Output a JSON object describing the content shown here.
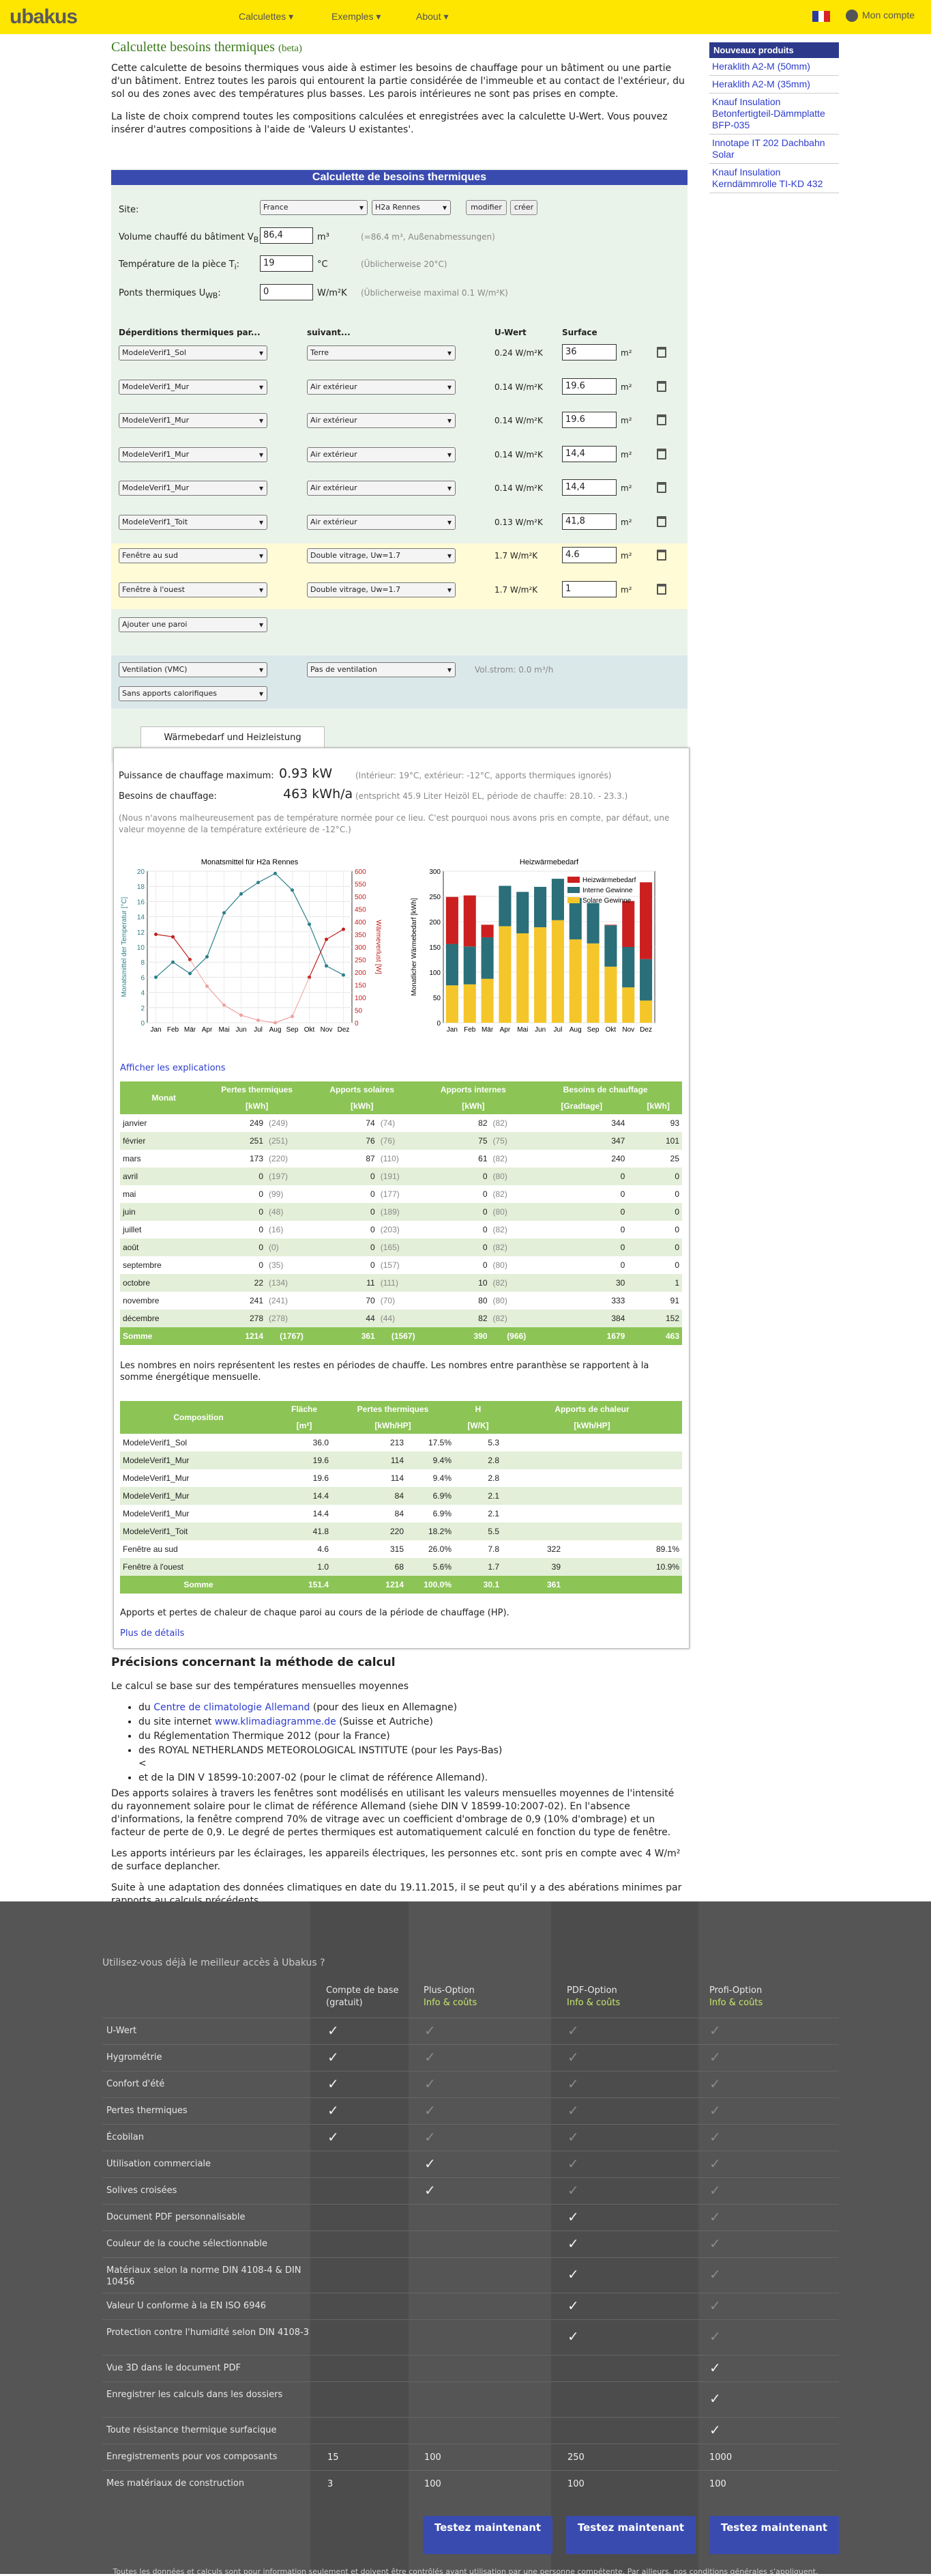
{
  "header": {
    "logo": "ubakus",
    "nav": [
      "Calculettes ▾",
      "Exemples ▾",
      "About ▾"
    ],
    "account": "Mon compte"
  },
  "sidebar": {
    "title": "Nouveaux produits",
    "items": [
      "Heraklith A2-M (50mm)",
      "Heraklith A2-M (35mm)",
      "Knauf Insulation Betonfertigteil-Dämmplatte BFP-035",
      "Innotape IT 202 Dachbahn Solar",
      "Knauf Insulation Kerndämmrolle TI-KD 432"
    ]
  },
  "page": {
    "title": "Calculette besoins thermiques",
    "beta": "(beta)",
    "intro1": "Cette calculette de besoins thermiques vous aide à estimer les besoins de chauffage pour un bâtiment ou une partie d'un bâtiment. Entrez toutes les parois qui entourent la partie considérée de l'immeuble et au contact de l'extérieur, du sol ou des zones avec des températures plus basses. Les parois intérieures ne sont pas prises en compte.",
    "intro2": "La liste de choix comprend toutes les compositions calculées et enregistrées avec la calculette U-Wert. Vous pouvez insérer d'autres compositions à l'aide de 'Valeurs U existantes'."
  },
  "form": {
    "title": "Calculette de besoins thermiques",
    "site_label": "Site:",
    "country": "France",
    "city": "H2a Rennes",
    "modify": "modifier",
    "create": "créer",
    "volume_label": "Volume chauffé du bâtiment V",
    "volume_sub": "B",
    "volume_value": "86,4",
    "volume_unit": "m³",
    "volume_hint": "(=86.4 m³, Außenabmessungen)",
    "temp_label": "Température de la pièce T",
    "temp_sub": "i",
    "temp_value": "19",
    "temp_unit": "°C",
    "temp_hint": "(Üblicherweise 20°C)",
    "bridge_label": "Ponts thermiques U",
    "bridge_sub": "WB",
    "bridge_value": "0",
    "bridge_unit": "W/m²K",
    "bridge_hint": "(Üblicherweise maximal 0.1 W/m²K)",
    "col_walls": "Déperditions thermiques par...",
    "col_next": "suivant...",
    "col_u": "U-Wert",
    "col_area": "Surface",
    "walls": [
      {
        "name": "ModeleVerif1_Sol",
        "next": "Terre",
        "u": "0.24 W/m²K",
        "area": "36",
        "unit": "m²"
      },
      {
        "name": "ModeleVerif1_Mur",
        "next": "Air extérieur",
        "u": "0.14 W/m²K",
        "area": "19.6",
        "unit": "m²"
      },
      {
        "name": "ModeleVerif1_Mur",
        "next": "Air extérieur",
        "u": "0.14 W/m²K",
        "area": "19.6",
        "unit": "m²"
      },
      {
        "name": "ModeleVerif1_Mur",
        "next": "Air extérieur",
        "u": "0.14 W/m²K",
        "area": "14,4",
        "unit": "m²"
      },
      {
        "name": "ModeleVerif1_Mur",
        "next": "Air extérieur",
        "u": "0.14 W/m²K",
        "area": "14,4",
        "unit": "m²"
      },
      {
        "name": "ModeleVerif1_Toit",
        "next": "Air extérieur",
        "u": "0.13 W/m²K",
        "area": "41,8",
        "unit": "m²"
      },
      {
        "name": "Fenêtre au sud",
        "next": "Double vitrage, Uw=1.7",
        "u": "1.7 W/m²K",
        "area": "4.6",
        "unit": "m²"
      },
      {
        "name": "Fenêtre à l'ouest",
        "next": "Double vitrage, Uw=1.7",
        "u": "1.7 W/m²K",
        "area": "1",
        "unit": "m²"
      }
    ],
    "add_wall": "Ajouter une paroi",
    "ventilation": "Ventilation (VMC)",
    "no_vent": "Pas de ventilation",
    "vol_strom": "Vol.strom: 0.0 m³/h",
    "no_gain": "Sans apports calorifiques"
  },
  "results": {
    "tab": "Wärmebedarf und Heizleistung",
    "power_label": "Puissance de chauffage maximum:",
    "power_value": "0.93 kW",
    "power_hint": "(Intérieur: 19°C, extérieur: -12°C, apports thermiques ignorés)",
    "need_label": "Besoins de chauffage:",
    "need_value": "463 kWh/a",
    "need_hint": "(entspricht 45.9 Liter Heizöl EL, période de chauffe: 28.10. - 23.3.)",
    "note": "(Nous n'avons malheureusement pas de température normée pour ce lieu. C'est pourquoi nous avons pris en compte, par défaut, une valeur moyenne de la température extérieure de -12°C.)",
    "show_expl": "Afficher les explications",
    "table_note": "Les nombres en noirs représentent les restes en périodes de chauffe. Les nombres entre paranthèse se rapportent à la somme énergétique mensuelle.",
    "comp_note": "Apports et pertes de chaleur de chaque paroi au cours de la période de chauffage (HP).",
    "more": "Plus de détails"
  },
  "monthly": {
    "headers": [
      "Monat",
      "Pertes thermiques",
      "Apports solaires",
      "Apports internes",
      "Besoins de chauffage"
    ],
    "units": [
      "[kWh]",
      "[kWh]",
      "[kWh]",
      "[Gradtage]",
      "[kWh]"
    ],
    "rows": [
      [
        "janvier",
        "249",
        "(249)",
        "74",
        "(74)",
        "82",
        "(82)",
        "344",
        "93"
      ],
      [
        "février",
        "251",
        "(251)",
        "76",
        "(76)",
        "75",
        "(75)",
        "347",
        "101"
      ],
      [
        "mars",
        "173",
        "(220)",
        "87",
        "(110)",
        "61",
        "(82)",
        "240",
        "25"
      ],
      [
        "avril",
        "0",
        "(197)",
        "0",
        "(191)",
        "0",
        "(80)",
        "0",
        "0"
      ],
      [
        "mai",
        "0",
        "(99)",
        "0",
        "(177)",
        "0",
        "(82)",
        "0",
        "0"
      ],
      [
        "juin",
        "0",
        "(48)",
        "0",
        "(189)",
        "0",
        "(80)",
        "0",
        "0"
      ],
      [
        "juillet",
        "0",
        "(16)",
        "0",
        "(203)",
        "0",
        "(82)",
        "0",
        "0"
      ],
      [
        "août",
        "0",
        "(0)",
        "0",
        "(165)",
        "0",
        "(82)",
        "0",
        "0"
      ],
      [
        "septembre",
        "0",
        "(35)",
        "0",
        "(157)",
        "0",
        "(80)",
        "0",
        "0"
      ],
      [
        "octobre",
        "22",
        "(134)",
        "11",
        "(111)",
        "10",
        "(82)",
        "30",
        "1"
      ],
      [
        "novembre",
        "241",
        "(241)",
        "70",
        "(70)",
        "80",
        "(80)",
        "333",
        "91"
      ],
      [
        "décembre",
        "278",
        "(278)",
        "44",
        "(44)",
        "82",
        "(82)",
        "384",
        "152"
      ]
    ],
    "sum": [
      "Somme",
      "1214",
      "(1767)",
      "361",
      "(1567)",
      "390",
      "(966)",
      "1679",
      "463"
    ]
  },
  "comp": {
    "headers": [
      "Composition",
      "Fläche",
      "Pertes thermiques",
      "H",
      "Apports de chaleur"
    ],
    "units": [
      "[m²]",
      "[kWh/HP]",
      "[W/K]",
      "[kWh/HP]"
    ],
    "rows": [
      [
        "ModeleVerif1_Sol",
        "36.0",
        "213",
        "17.5%",
        "5.3",
        "",
        ""
      ],
      [
        "ModeleVerif1_Mur",
        "19.6",
        "114",
        "9.4%",
        "2.8",
        "",
        ""
      ],
      [
        "ModeleVerif1_Mur",
        "19.6",
        "114",
        "9.4%",
        "2.8",
        "",
        ""
      ],
      [
        "ModeleVerif1_Mur",
        "14.4",
        "84",
        "6.9%",
        "2.1",
        "",
        ""
      ],
      [
        "ModeleVerif1_Mur",
        "14.4",
        "84",
        "6.9%",
        "2.1",
        "",
        ""
      ],
      [
        "ModeleVerif1_Toit",
        "41.8",
        "220",
        "18.2%",
        "5.5",
        "",
        ""
      ],
      [
        "Fenêtre au sud",
        "4.6",
        "315",
        "26.0%",
        "7.8",
        "322",
        "89.1%"
      ],
      [
        "Fenêtre à l'ouest",
        "1.0",
        "68",
        "5.6%",
        "1.7",
        "39",
        "10.9%"
      ]
    ],
    "sum": [
      "Somme",
      "151.4",
      "1214",
      "100.0%",
      "30.1",
      "361",
      ""
    ]
  },
  "chart_data": [
    {
      "type": "line",
      "title": "Monatsmittel für H2a Rennes",
      "categories": [
        "Jan",
        "Feb",
        "Mär",
        "Apr",
        "Mai",
        "Jun",
        "Jul",
        "Aug",
        "Sep",
        "Okt",
        "Nov",
        "Dez"
      ],
      "ylabel": "Monatsmittel der Temperatur [°C]",
      "y2label": "Wärmeverlust [W]",
      "ylim": [
        0,
        20
      ],
      "y2lim": [
        0,
        600
      ],
      "yticks": [
        "0",
        "2",
        "4",
        "6",
        "8",
        "10",
        "12",
        "14",
        "16",
        "18",
        "20"
      ],
      "y2ticks": [
        "0",
        "50",
        "100",
        "150",
        "200",
        "250",
        "300",
        "350",
        "400",
        "450",
        "500",
        "550",
        "600"
      ],
      "series": [
        {
          "name": "",
          "values": [
            6.0,
            8.0,
            6.5,
            8.7,
            14.5,
            17.0,
            18.5,
            19.7,
            17.5,
            13.0,
            7.5,
            6.3
          ],
          "color": "#2a7f8a"
        },
        {
          "values": [
            350,
            340,
            250,
            null,
            null,
            null,
            null,
            null,
            null,
            180,
            330,
            370
          ],
          "color": "#c0201c"
        },
        {
          "values": [
            null,
            null,
            null,
            145,
            70,
            30,
            10,
            0,
            25,
            null,
            null,
            null
          ],
          "color": "#f0a0a0"
        }
      ]
    },
    {
      "type": "bar",
      "title": "Heizwärmebedarf",
      "categories": [
        "Jan",
        "Feb",
        "Mär",
        "Apr",
        "Mai",
        "Jun",
        "Jul",
        "Aug",
        "Sep",
        "Okt",
        "Nov",
        "Dez"
      ],
      "ylabel": "Monatlicher Wärmebedarf [kWh]",
      "ylim": [
        0,
        300
      ],
      "yticks": [
        "0",
        "50",
        "100",
        "150",
        "200",
        "250",
        "300"
      ],
      "legend": [
        "Heizwärmebedarf",
        "Interne Gewinne",
        "Solare Gewinne"
      ],
      "series": [
        {
          "name": "Solare Gewinne",
          "values": [
            74,
            76,
            87,
            191,
            177,
            189,
            203,
            165,
            157,
            111,
            70,
            44
          ],
          "color": "#f5c629"
        },
        {
          "name": "Interne Gewinne",
          "values": [
            82,
            75,
            82,
            80,
            82,
            80,
            82,
            82,
            80,
            82,
            80,
            82
          ],
          "color": "#2a6f79"
        },
        {
          "name": "Heizwärmebedarf",
          "values": [
            93,
            101,
            25,
            0,
            0,
            0,
            0,
            0,
            0,
            1,
            91,
            152
          ],
          "color": "#cc1f1f"
        }
      ]
    }
  ],
  "method": {
    "title": "Précisions concernant la méthode de calcul",
    "p1": "Le calcul se base sur des températures mensuelles moyennes",
    "li1a": "du ",
    "li1b": "Centre de climatologie Allemand",
    "li1c": " (pour des lieux en Allemagne)",
    "li2a": "du site internet ",
    "li2b": "www.klimadiagramme.de",
    "li2c": " (Suisse et Autriche)",
    "li3": "du Réglementation Thermique 2012 (pour la France)",
    "li4": "des ROYAL NETHERLANDS METEOROLOGICAL INSTITUTE (pour les Pays-Bas)",
    "li4b": "<",
    "li5": "et de la DIN V 18599-10:2007-02 (pour le climat de référence Allemand).",
    "p2": "Des apports solaires à travers les fenêtres sont modélisés en utilisant les valeurs mensuelles moyennes de l'intensité du rayonnement solaire pour le climat de référence Allemand (siehe DIN V 18599-10:2007-02). En l'absence d'informations, la fenêtre comprend 70% de vitrage avec un coefficient d'ombrage de 0,9 (10% d'ombrage) et un facteur de perte de 0,9. Le degré de pertes thermiques est automatiquement calculé en fonction du type de fenêtre.",
    "p3": "Les apports intérieurs par les éclairages, les appareils électriques, les personnes etc. sont pris en compte avec 4 W/m² de surface deplancher.",
    "p4": "Suite à une adaptation des données climatiques en date du 19.11.2015, il se peut qu'il y a des abérations minimes par rapports au calculs précédents"
  },
  "footer": {
    "question": "Utilisez-vous déjà le meilleur accès à Ubakus ?",
    "cols": [
      {
        "title": "Compte de base",
        "sub": "(gratuit)"
      },
      {
        "title": "Plus-Option",
        "sub": "Info & coûts"
      },
      {
        "title": "PDF-Option",
        "sub": "Info & coûts"
      },
      {
        "title": "Profi-Option",
        "sub": "Info & coûts"
      }
    ],
    "features": [
      {
        "label": "U-Wert",
        "c": [
          "y",
          "d",
          "d",
          "d"
        ]
      },
      {
        "label": "Hygrométrie",
        "c": [
          "y",
          "d",
          "d",
          "d"
        ]
      },
      {
        "label": "Confort d'été",
        "c": [
          "y",
          "d",
          "d",
          "d"
        ]
      },
      {
        "label": "Pertes thermiques",
        "c": [
          "y",
          "d",
          "d",
          "d"
        ]
      },
      {
        "label": "Écobilan",
        "c": [
          "y",
          "d",
          "d",
          "d"
        ]
      },
      {
        "label": "Utilisation commerciale",
        "c": [
          "",
          "y",
          "d",
          "d"
        ]
      },
      {
        "label": "Solives croisées",
        "c": [
          "",
          "y",
          "d",
          "d"
        ]
      },
      {
        "label": "Document PDF personnalisable",
        "c": [
          "",
          "",
          "y",
          "d"
        ]
      },
      {
        "label": "Couleur de la couche sélectionnable",
        "c": [
          "",
          "",
          "y",
          "d"
        ]
      },
      {
        "label": "Matériaux selon la norme DIN 4108-4 & DIN 10456",
        "c": [
          "",
          "",
          "y",
          "d"
        ]
      },
      {
        "label": "Valeur U conforme à la EN ISO 6946",
        "c": [
          "",
          "",
          "y",
          "d"
        ]
      },
      {
        "label": "Protection contre l'humidité selon DIN 4108-3",
        "c": [
          "",
          "",
          "y",
          "d"
        ]
      },
      {
        "label": "Vue 3D dans le document PDF",
        "c": [
          "",
          "",
          "",
          "y"
        ]
      },
      {
        "label": "Enregistrer les calculs dans les dossiers",
        "c": [
          "",
          "",
          "",
          "y"
        ]
      },
      {
        "label": "Toute résistance thermique surfacique",
        "c": [
          "",
          "",
          "",
          "y"
        ]
      },
      {
        "label": "Enregistrements pour vos composants",
        "c": [
          "15",
          "100",
          "250",
          "1000"
        ]
      },
      {
        "label": "Mes matériaux de construction",
        "c": [
          "3",
          "100",
          "100",
          "100"
        ]
      }
    ],
    "try": "Testez maintenant",
    "disclaimer": "Toutes les données et calculs sont pour information seulement et doivent être contrôlés avant utilisation par une personne compétente. Par ailleurs, nos conditions générales s'appliquent."
  }
}
